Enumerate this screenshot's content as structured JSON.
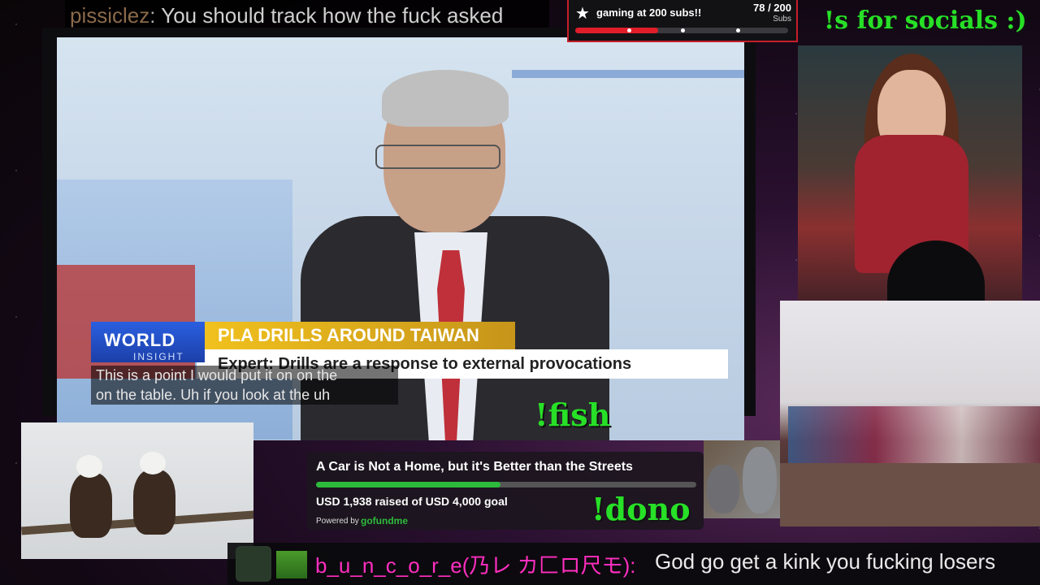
{
  "chat_top": {
    "username": "pissiclez",
    "separator": ":",
    "message": "You should track how the fuck asked"
  },
  "sub_goal": {
    "star_icon": "star-icon",
    "label": "gaming at 200 subs!!",
    "count": "78 / 200",
    "units": "Subs",
    "progress": 0.39,
    "accent": "#e11d2a"
  },
  "socials_command": "!s for socials :)",
  "broadcast": {
    "brand_line1": "WORLD",
    "brand_line2": "INSIGHT",
    "headline": "PLA DRILLS AROUND TAIWAN",
    "subline": "Expert: Drills are a response to external provocations",
    "caption_line1": "This is a point I would put it on on the",
    "caption_line2": "on the table. Uh if you look at the uh"
  },
  "fish_command": "!fish",
  "dono_command": "!dono",
  "gofundme": {
    "title": "A Car is Not a Home, but it's Better than the Streets",
    "raised_text": "USD 1,938 raised of USD 4,000 goal",
    "progress": 0.4845,
    "powered_by": "Powered by",
    "brand": "gofundme",
    "accent": "#2dbb3c"
  },
  "chat_bottom": {
    "username": "b_u_n_c_o_r_e(乃レ カ匚ロ尺モ):",
    "message": "God go get a kink you fucking losers",
    "username_color": "#ff2ec0"
  },
  "colors": {
    "command_green": "#27e027",
    "goal_border": "#c81d2a"
  }
}
